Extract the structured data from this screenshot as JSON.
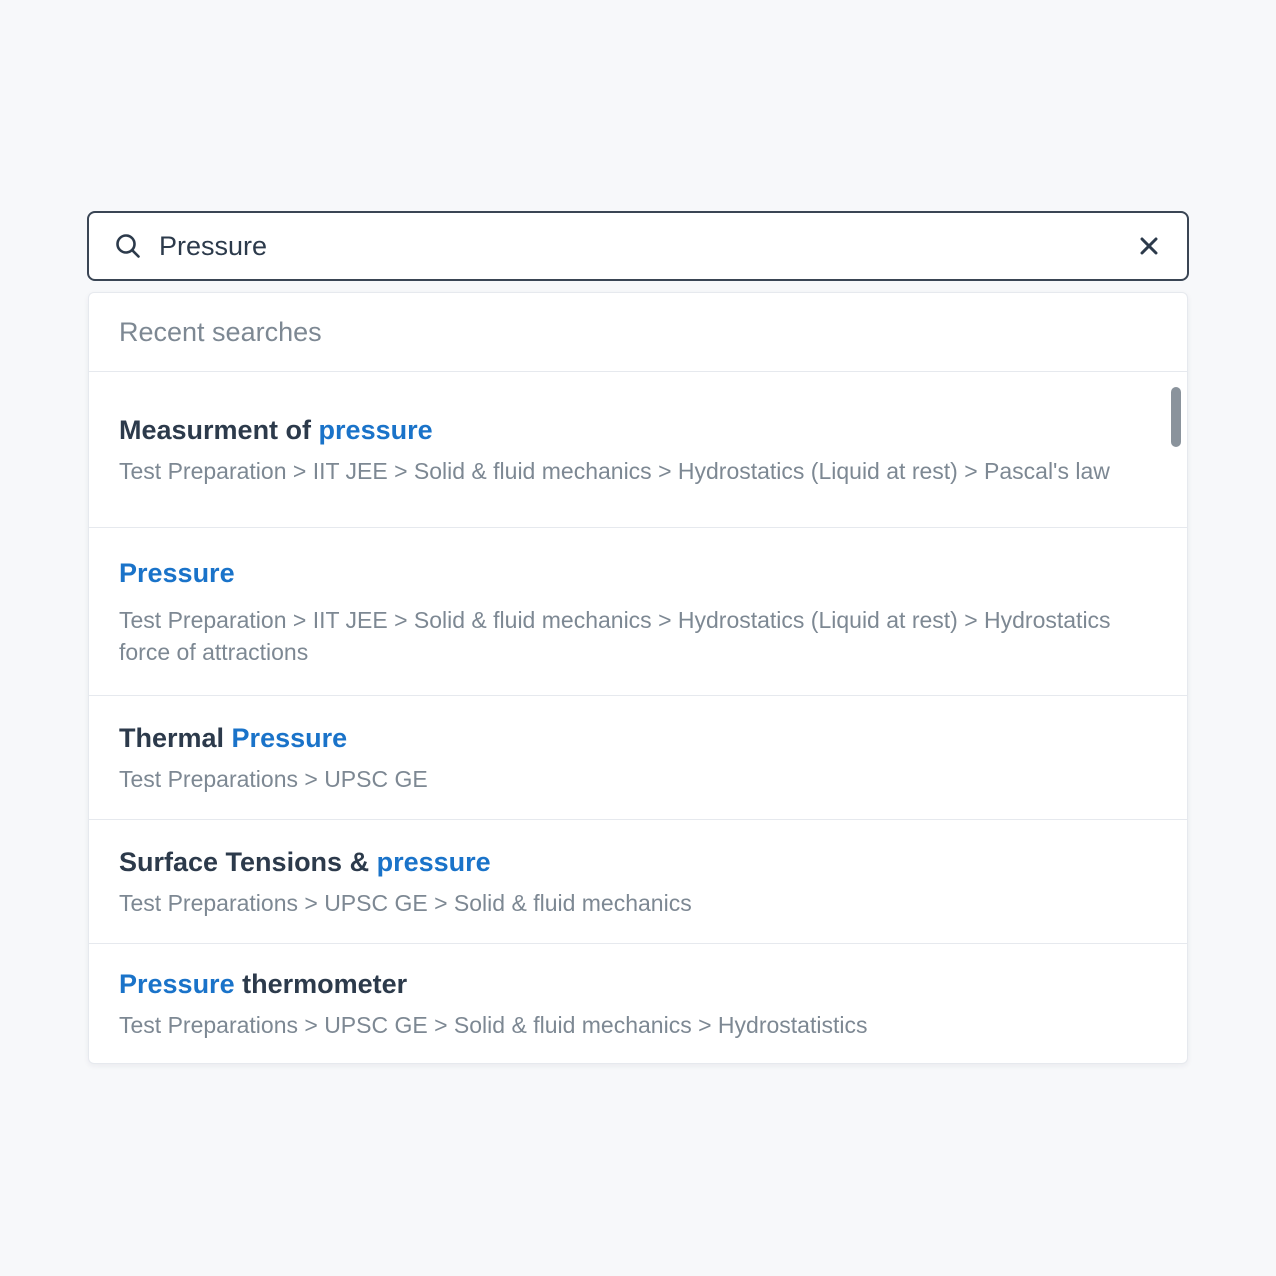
{
  "search": {
    "value": "Pressure",
    "placeholder": ""
  },
  "dropdown": {
    "header": "Recent searches",
    "results": [
      {
        "title_parts": [
          "Measurment of ",
          "pressure"
        ],
        "path": "Test Preparation > IIT JEE > Solid & fluid mechanics > Hydrostatics (Liquid at rest) > Pascal's law"
      },
      {
        "title_parts": [
          "Pressure"
        ],
        "path": "Test Preparation > IIT JEE > Solid & fluid mechanics > Hydrostatics (Liquid at rest) > Hydrostatics force of attractions"
      },
      {
        "title_parts": [
          "Thermal ",
          "Pressure"
        ],
        "path": "Test Preparations > UPSC GE"
      },
      {
        "title_parts": [
          "Surface Tensions & ",
          "pressure"
        ],
        "path": "Test Preparations > UPSC GE > Solid & fluid mechanics"
      },
      {
        "title_parts": [
          "Pressure",
          " thermometer"
        ],
        "path": "Test Preparations > UPSC GE > Solid & fluid mechanics > Hydrostatistics"
      }
    ]
  },
  "icons": {
    "search": "search-icon",
    "clear": "close-icon"
  },
  "colors": {
    "highlight": "#1a73c9",
    "text": "#2c3a4b",
    "muted": "#7d8893",
    "border": "#3a4554"
  }
}
